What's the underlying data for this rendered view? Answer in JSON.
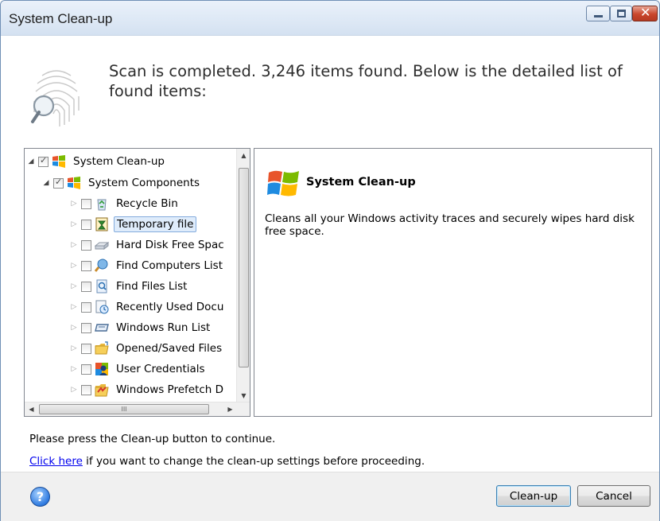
{
  "window": {
    "title": "System Clean-up",
    "buttons": [
      "minimize",
      "maximize",
      "close"
    ]
  },
  "header": {
    "text": "Scan is completed. 3,246 items found. Below is the detailed list of found items:",
    "icon": "fingerprint-magnifier-icon"
  },
  "tree": {
    "root": {
      "label": "System Clean-up",
      "checked": true,
      "expanded": true,
      "icon": "windows-logo-icon"
    },
    "group": {
      "label": "System Components",
      "checked": true,
      "expanded": true,
      "icon": "windows-logo-icon"
    },
    "items": [
      {
        "label": "Recycle Bin",
        "checked": false,
        "icon": "recycle-bin-icon",
        "selected": false
      },
      {
        "label": "Temporary file",
        "checked": false,
        "icon": "temporary-file-icon",
        "selected": true
      },
      {
        "label": "Hard Disk Free Spac",
        "checked": false,
        "icon": "hard-disk-icon",
        "selected": false
      },
      {
        "label": "Find Computers List",
        "checked": false,
        "icon": "find-computers-icon",
        "selected": false
      },
      {
        "label": "Find Files List",
        "checked": false,
        "icon": "find-files-icon",
        "selected": false
      },
      {
        "label": "Recently Used Docu",
        "checked": false,
        "icon": "recent-documents-icon",
        "selected": false
      },
      {
        "label": "Windows Run List",
        "checked": false,
        "icon": "run-list-icon",
        "selected": false
      },
      {
        "label": "Opened/Saved Files",
        "checked": false,
        "icon": "folder-icon",
        "selected": false
      },
      {
        "label": "User Credentials",
        "checked": false,
        "icon": "user-credentials-icon",
        "selected": false
      },
      {
        "label": "Windows Prefetch D",
        "checked": false,
        "icon": "prefetch-icon",
        "selected": false
      }
    ],
    "hscroll_glyph": "III"
  },
  "detail": {
    "title": "System Clean-up",
    "description": "Cleans all your Windows activity traces and securely wipes hard disk free space.",
    "icon": "windows-logo-icon"
  },
  "notes": {
    "press": "Please press the Clean-up button to continue.",
    "link": "Click here",
    "link_suffix": " if you want to change the clean-up settings before proceeding."
  },
  "footer": {
    "help_glyph": "?",
    "cleanup_label": "Clean-up",
    "cancel_label": "Cancel"
  },
  "colors": {
    "titlebar": "#dde8f5",
    "selection": "#dfecfb",
    "link": "#0000ee",
    "close_button": "#c9462c"
  }
}
